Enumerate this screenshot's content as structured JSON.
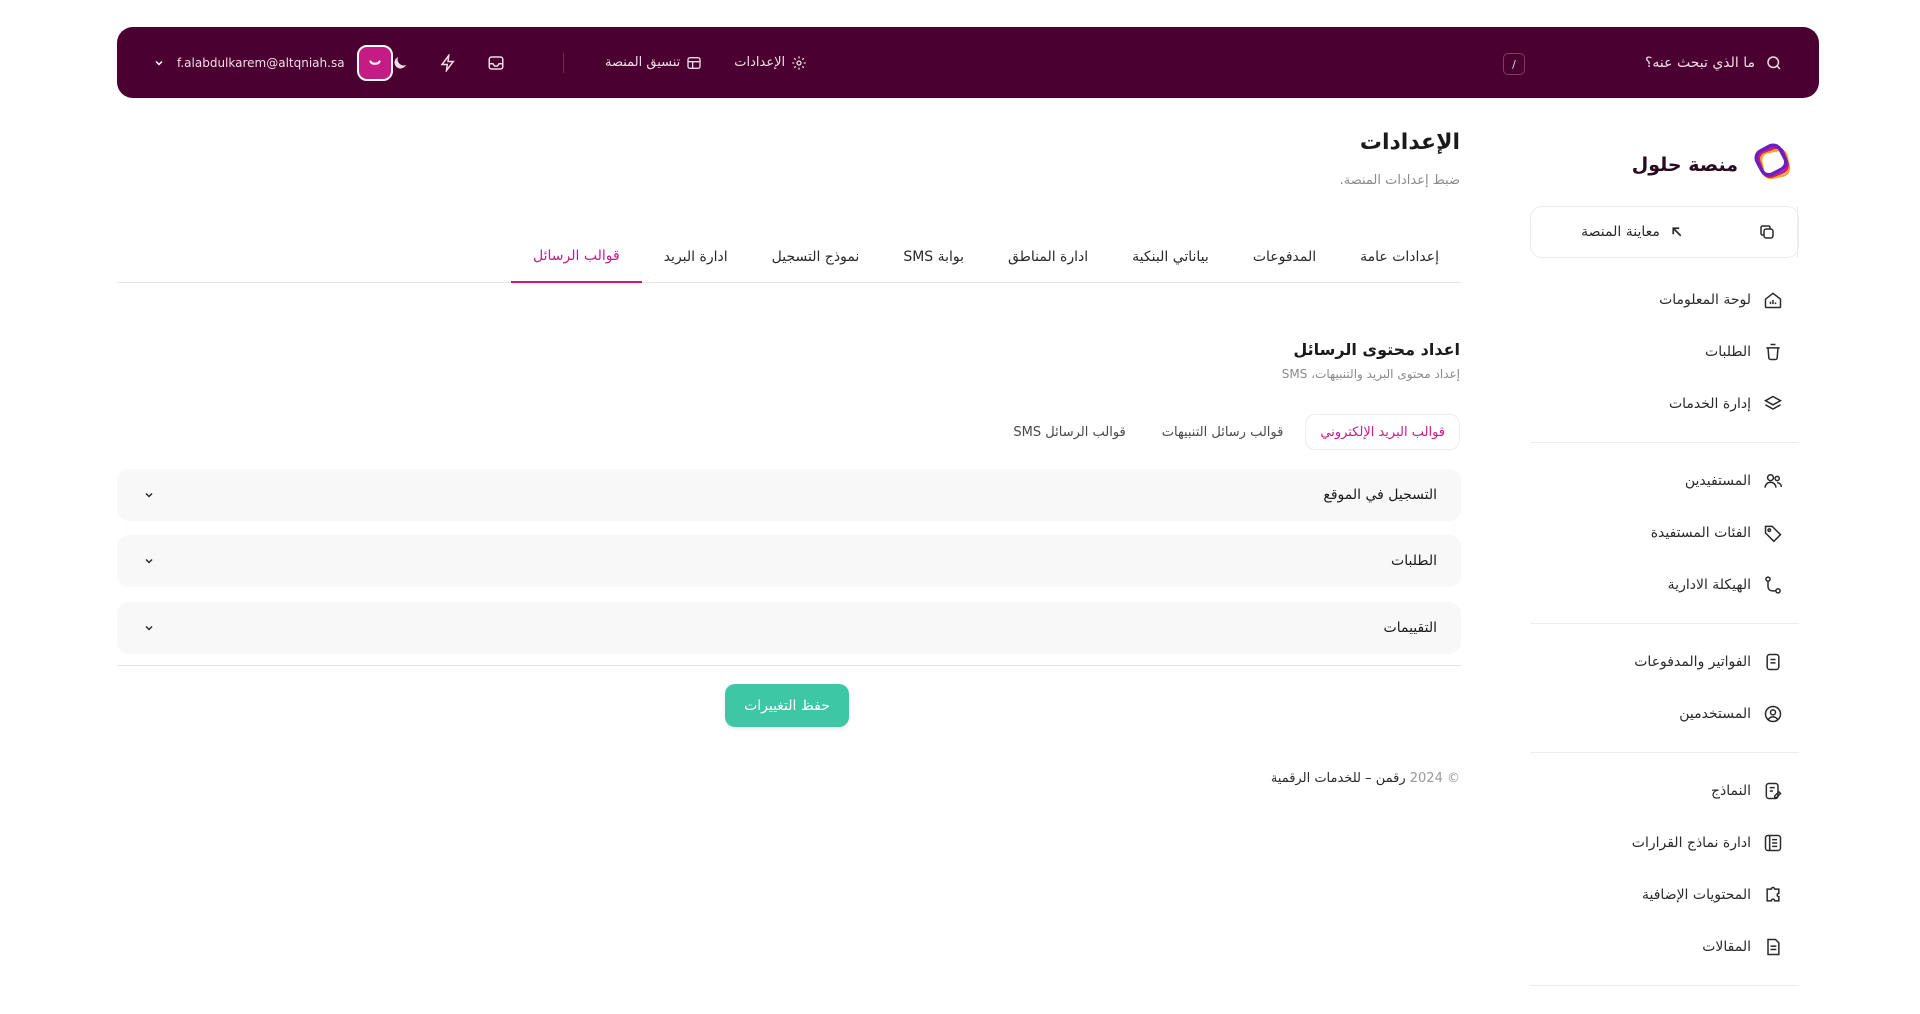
{
  "topbar": {
    "search_placeholder": "ما الذي تبحث عنه؟",
    "shortcut": "/",
    "links": [
      {
        "label": "تنسيق المنصة",
        "icon": "layout-icon"
      },
      {
        "label": "الإعدادات",
        "icon": "gear-icon"
      }
    ],
    "icons": [
      "inbox-icon",
      "lightning-icon",
      "moon-icon"
    ],
    "user_email": "f.alabdulkarem@altqniah.sa"
  },
  "sidebar": {
    "brand": "منصة حلول",
    "preview_label": "معاينة المنصة",
    "groups": [
      [
        {
          "label": "لوحة المعلومات",
          "icon": "dashboard-icon"
        },
        {
          "label": "الطلبات",
          "icon": "orders-icon"
        },
        {
          "label": "إدارة الخدمات",
          "icon": "layers-icon"
        }
      ],
      [
        {
          "label": "المستفيدين",
          "icon": "users-icon"
        },
        {
          "label": "الفئات المستفيدة",
          "icon": "tag-icon"
        },
        {
          "label": "الهيكلة الادارية",
          "icon": "route-icon"
        }
      ],
      [
        {
          "label": "الفواتير والمدفوعات",
          "icon": "invoice-icon"
        },
        {
          "label": "المستخدمين",
          "icon": "user-circle-icon"
        }
      ],
      [
        {
          "label": "النماذج",
          "icon": "form-icon"
        },
        {
          "label": "ادارة نماذج القرارات",
          "icon": "list-icon"
        },
        {
          "label": "المحتويات الإضافية",
          "icon": "puzzle-icon"
        },
        {
          "label": "المقالات",
          "icon": "article-icon"
        }
      ]
    ]
  },
  "page": {
    "title": "الإعدادات",
    "subtitle": "ضبط إعدادات المنصة."
  },
  "tabs": [
    "إعدادات عامة",
    "المدفوعات",
    "بياناتي البنكية",
    "ادارة المناطق",
    "بوابة SMS",
    "نموذج التسجيل",
    "ادارة البريد",
    "قوالب الرسائل"
  ],
  "active_tab": 7,
  "section": {
    "title": "اعداد محتوى الرسائل",
    "subtitle": "إعداد محتوى البريد والتنبيهات، SMS"
  },
  "subtabs": [
    "قوالب البريد الإلكتروني",
    "قوالب رسائل التنبيهات",
    "قوالب الرسائل SMS"
  ],
  "active_subtab": 0,
  "accordions": [
    "التسجيل في الموقع",
    "الطلبات",
    "التقييمات"
  ],
  "save_label": "حفظ التغييرات",
  "footer": {
    "copyright": "© 2024",
    "text": "رقمن – للخدمات الرقمية"
  },
  "colors": {
    "topbar": "#4a0030",
    "accent": "#c41b84",
    "save": "#3ec7a5"
  }
}
